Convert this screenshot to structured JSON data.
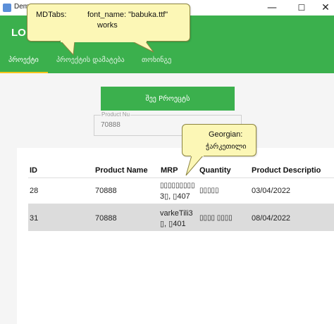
{
  "window": {
    "title": "Dem",
    "min_glyph": "—",
    "max_glyph": "☐",
    "close_glyph": "✕",
    "icon": "app-icon"
  },
  "appbar": {
    "title": "LO",
    "color": "#3bb04d"
  },
  "tabs": [
    {
      "label": "პროექტი",
      "active": true
    },
    {
      "label": "პროექტის დამატება",
      "active": false
    },
    {
      "label": "თოხინგე",
      "active": false
    }
  ],
  "accent": "#f5c51b",
  "form": {
    "add_button_label": "შეე Pროეცტს",
    "product_field_label": "Product Nu",
    "product_field_value": "70888"
  },
  "table": {
    "headers": [
      "ID",
      "Product Name",
      "MRP",
      "Quantity",
      "Product Descriptio"
    ],
    "rows": [
      {
        "id": "28",
        "name": "70888",
        "mrp_line1": "▯▯▯▯▯▯▯▯▯",
        "mrp_line2": "3▯, ▯407",
        "qty": "▯▯▯▯▯",
        "date": "03/04/2022"
      },
      {
        "id": "31",
        "name": "70888",
        "mrp_line1": "varkeTili3",
        "mrp_line2": "▯, ▯401",
        "qty": "▯▯▯▯ ▯▯▯▯",
        "date": "08/04/2022"
      }
    ]
  },
  "tooltips": {
    "mdtabs_a": "MDTabs:",
    "mdtabs_b": "font_name: \"babuka.ttf\"",
    "mdtabs_c": "works",
    "georgian_title": "Georgian:",
    "georgian_sample": "ჭარკეთილი"
  }
}
